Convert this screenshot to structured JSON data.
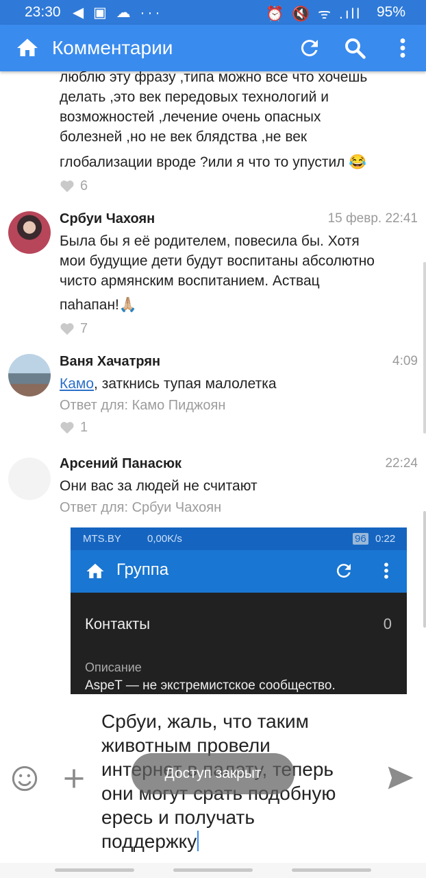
{
  "status_bar": {
    "time": "23:30",
    "left_icons": "◀ ▣ ☁ ···",
    "right_icons": "⏰ 🔇 ᯤ .ıll",
    "battery": "95%"
  },
  "app_bar": {
    "title": "Комментарии",
    "icons": [
      "home-icon",
      "refresh-icon",
      "search-icon",
      "more-icon"
    ]
  },
  "comments": [
    {
      "text_lines": [
        "люблю эту фразу ,типа можно все что хочешь",
        "делать ,это век передовых технологий и",
        "возможностей ,лечение очень опасных",
        "болезней ,но не век блядства ,не век",
        "глобализации вроде ?или я что то упустил 😂"
      ],
      "likes": "6"
    },
    {
      "author": "Србуи Чахоян",
      "date": "15 февр. 22:41",
      "text_lines": [
        "Была бы я её родителем, повесила бы. Хотя",
        "мои будущие дети будут воспитаны абсолютно",
        "чисто армянским воспитанием. Аствац",
        "паhапан!🙏🏼"
      ],
      "likes": "7"
    },
    {
      "author": "Ваня Хачатрян",
      "date": "4:09",
      "mention": "Камо",
      "text_after_mention": ", заткнись тупая малолетка",
      "reply_to": "Ответ для: Камо Пиджоян",
      "likes": "1"
    },
    {
      "author": "Арсений Панасюк",
      "date": "22:24",
      "text": "Они вас за людей не считают",
      "reply_to": "Ответ для: Србуи Чахоян"
    }
  ],
  "embedded_screenshot": {
    "carrier": "MTS.BY",
    "speed": "0,00K/s",
    "battery": "96",
    "time": "0:22",
    "title": "Группа",
    "contacts_label": "Контакты",
    "contacts_count": "0",
    "description_label": "Описание",
    "description": "AspeT — не экстремистское сообщество."
  },
  "composer": {
    "draft_lines": [
      "Србуи, жаль, что таким",
      "животным провели",
      "интернет в палату, теперь",
      "они могут срать подобную",
      "ересь и получать",
      "поддержку"
    ]
  },
  "toast": {
    "text": "Доступ закрыт"
  }
}
